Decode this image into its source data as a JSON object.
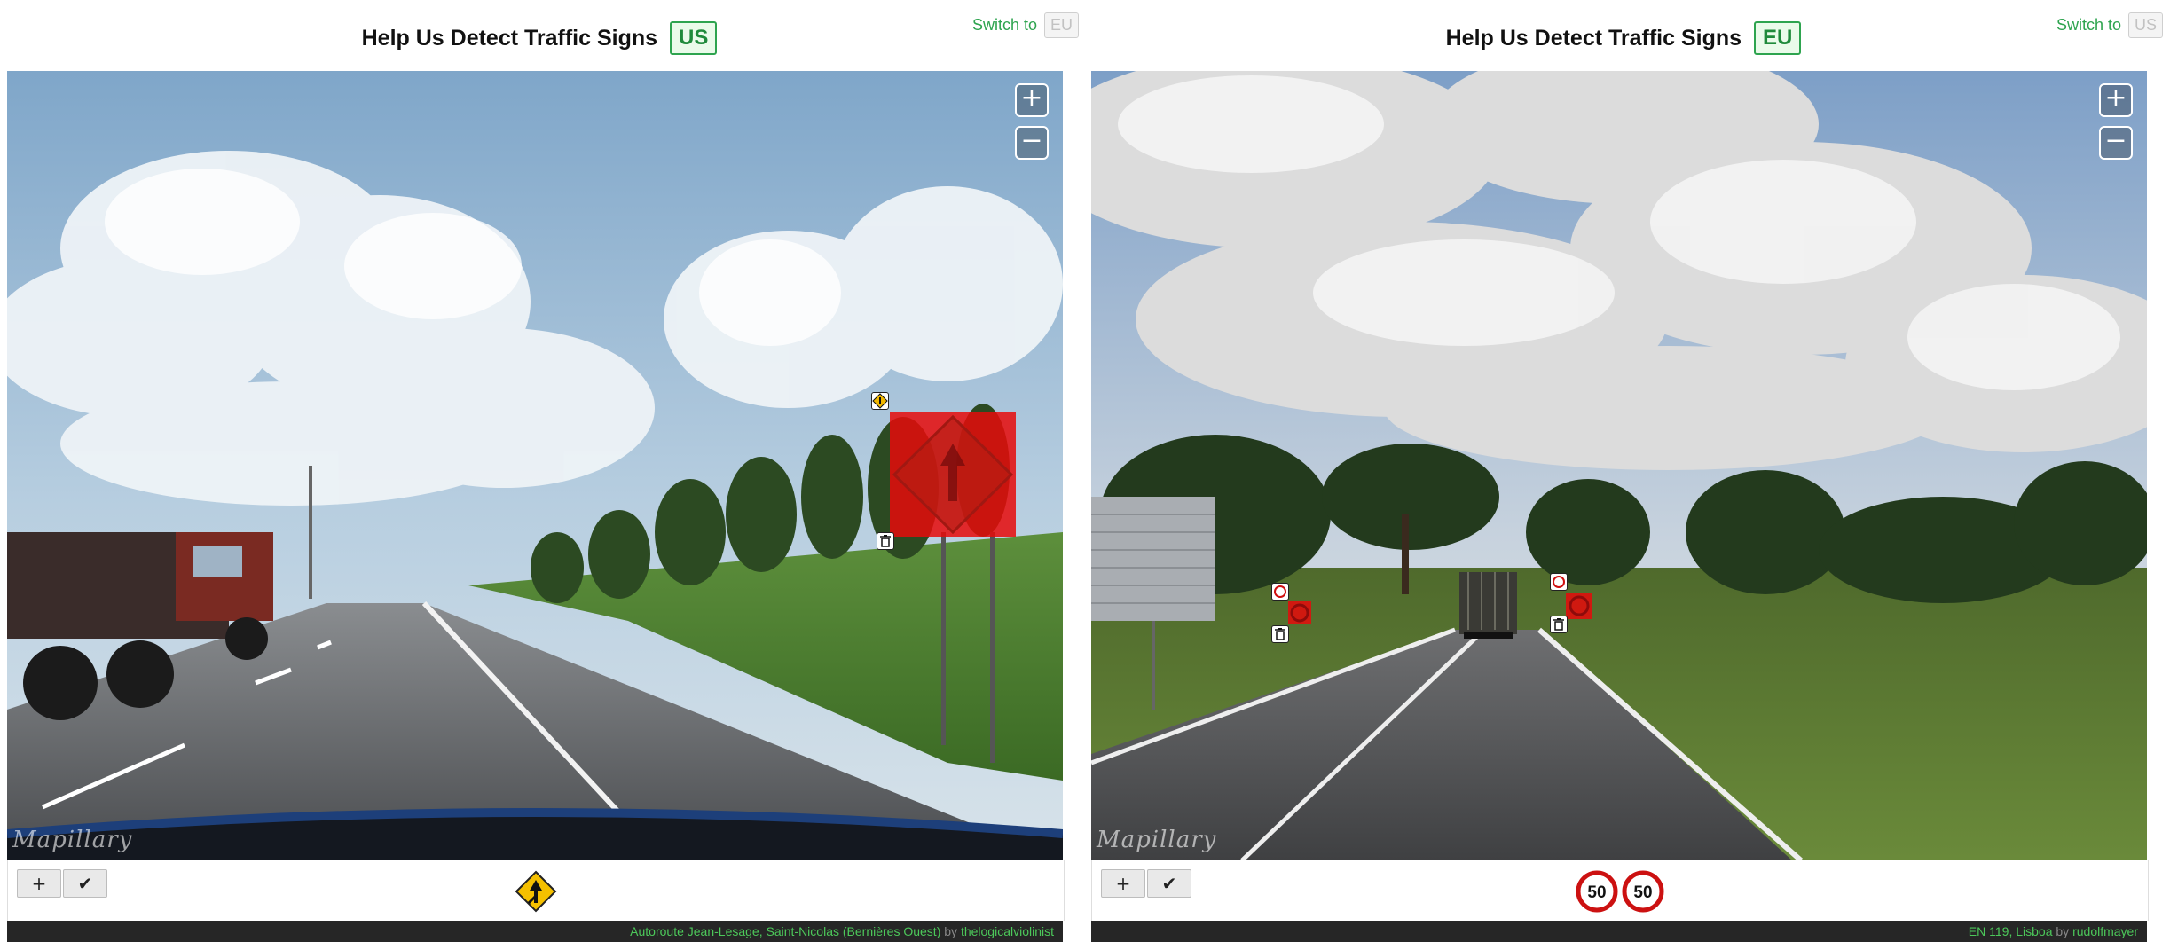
{
  "panels": {
    "us": {
      "title": "Help Us Detect Traffic Signs",
      "region_badge": "US",
      "switch_label": "Switch to",
      "switch_target": "EU",
      "zoom_in": "+",
      "zoom_out": "−",
      "watermark": "Mapillary",
      "toolbar": {
        "add_label": "+",
        "confirm_label": "✔"
      },
      "detected_signs": [
        {
          "icon": "merge-warning-sign-icon"
        }
      ],
      "footer": {
        "location": "Autoroute Jean-Lesage, Saint-Nicolas (Bernières Ouest)",
        "by": "by",
        "user": "thelogicalviolinist"
      },
      "annotation_icons": [
        "merge-sign-thumbnail-icon",
        "trash-icon"
      ]
    },
    "eu": {
      "title": "Help Us Detect Traffic Signs",
      "region_badge": "EU",
      "switch_label": "Switch to",
      "switch_target": "US",
      "zoom_in": "+",
      "zoom_out": "−",
      "watermark": "Mapillary",
      "toolbar": {
        "add_label": "+",
        "confirm_label": "✔"
      },
      "detected_signs": [
        {
          "text": "50",
          "icon": "speed-limit-sign-icon"
        },
        {
          "text": "50",
          "icon": "speed-limit-sign-icon"
        }
      ],
      "footer": {
        "location": "EN 119, Lisboa",
        "by": "by",
        "user": "rudolfmayer"
      },
      "annotation_icons": [
        "speed-limit-thumbnail-icon",
        "trash-icon"
      ]
    }
  },
  "colors": {
    "accent_green": "#2ea44f",
    "detection_red": "#e60a0a",
    "footer_bg": "#262626"
  }
}
